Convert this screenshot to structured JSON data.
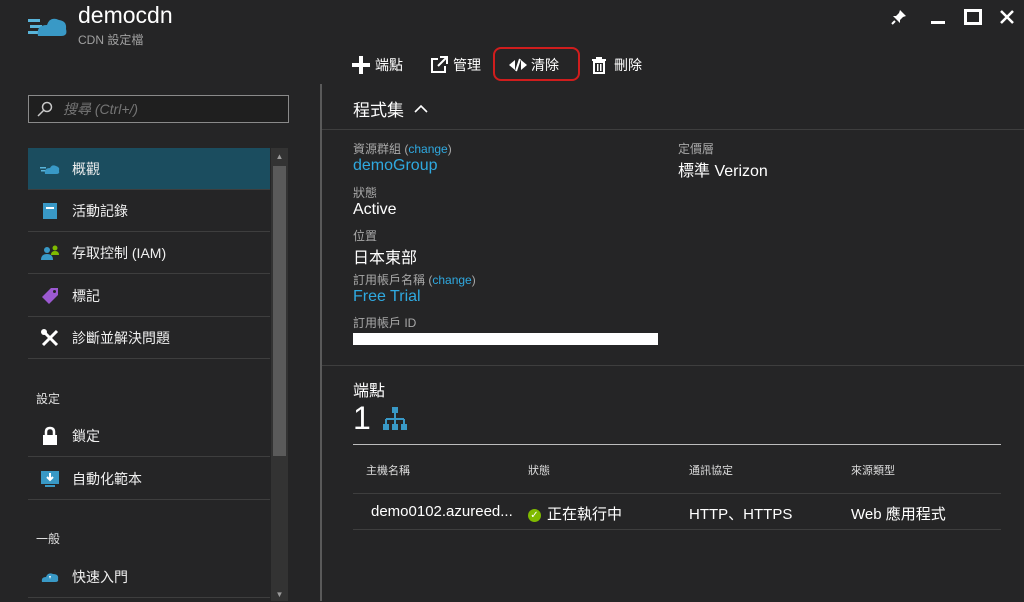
{
  "app": {
    "title": "democdn",
    "subtitle": "CDN 設定檔"
  },
  "window_controls": {
    "pin_icon": "pin-icon",
    "minimize_icon": "minimize-icon",
    "maximize_icon": "maximize-icon",
    "close_icon": "close-icon"
  },
  "toolbar": {
    "endpoint_label": "端點",
    "manage_label": "管理",
    "purge_label": "清除",
    "delete_label": "刪除",
    "highlight_color": "#d01d1d"
  },
  "sidebar": {
    "search_placeholder": "搜尋 (Ctrl+/)",
    "items": [
      {
        "label": "概觀",
        "icon": "cloud-icon",
        "active": true
      },
      {
        "label": "活動記錄",
        "icon": "activity-log-icon"
      },
      {
        "label": "存取控制 (IAM)",
        "icon": "people-icon"
      },
      {
        "label": "標記",
        "icon": "tag-icon"
      },
      {
        "label": "診斷並解決問題",
        "icon": "wrench-icon"
      }
    ],
    "section_settings": "設定",
    "settings_items": [
      {
        "label": "鎖定",
        "icon": "lock-icon"
      },
      {
        "label": "自動化範本",
        "icon": "download-template-icon"
      }
    ],
    "section_general": "一般",
    "general_items": [
      {
        "label": "快速入門",
        "icon": "cloud-quickstart-icon"
      }
    ]
  },
  "essentials": {
    "toggle_label": "程式集",
    "resource_group_label": "資源群組",
    "change_label": "change",
    "resource_group_value": "demoGroup",
    "status_label": "狀態",
    "status_value": "Active",
    "location_label": "位置",
    "location_value": "日本東部",
    "subscription_label": "訂用帳戶名稱",
    "subscription_value": "Free Trial",
    "subscription_id_label": "訂用帳戶 ID",
    "pricing_tier_label": "定價層",
    "pricing_tier_value": "標準 Verizon"
  },
  "endpoints": {
    "title": "端點",
    "count": "1",
    "columns": [
      "主機名稱",
      "狀態",
      "通訊協定",
      "來源類型"
    ],
    "rows": [
      {
        "host": "demo0102.azureed...",
        "status": "正在執行中",
        "protocol": "HTTP、HTTPS",
        "origin_type": "Web 應用程式"
      }
    ]
  },
  "colors": {
    "accent": "#2fa9e0",
    "active_nav": "#1b4d5f",
    "status_ok": "#7fba00"
  }
}
